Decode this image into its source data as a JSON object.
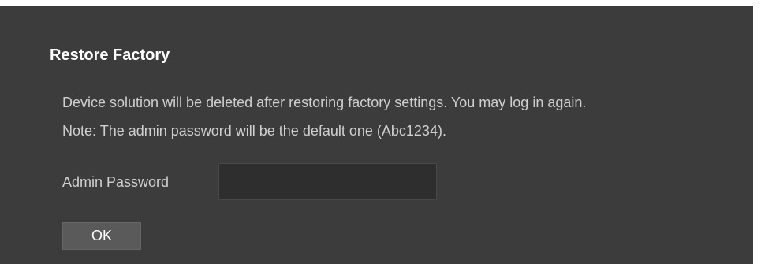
{
  "dialog": {
    "title": "Restore Factory",
    "message_line1": "Device solution will be deleted after restoring factory settings. You may log in again.",
    "message_line2": "Note: The admin password will be the default one (Abc1234).",
    "password_label": "Admin Password",
    "password_value": "",
    "ok_label": "OK"
  },
  "colors": {
    "background": "#3c3c3c",
    "title_text": "#ffffff",
    "body_text": "#cfcfcf",
    "input_background": "#2e2e2e",
    "button_background": "#5a5a5a"
  }
}
